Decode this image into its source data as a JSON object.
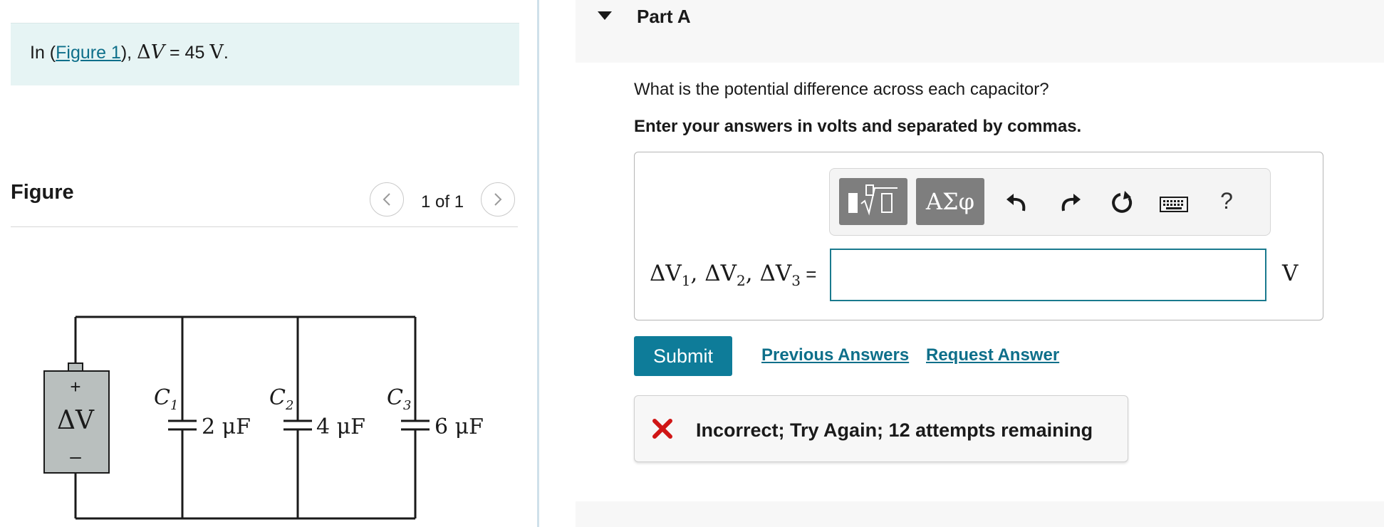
{
  "problem": {
    "prefix": "In (",
    "figure_link": "Figure 1",
    "suffix": "), ",
    "math_delta": "Δ",
    "math_var": "V",
    "math_eq": " = 45 ",
    "math_unit": "V",
    "period": "."
  },
  "figure": {
    "heading": "Figure",
    "pager_text": "1 of 1",
    "circuit": {
      "battery_plus": "+",
      "battery_label": "ΔV",
      "battery_minus": "–",
      "capacitors": [
        {
          "label": "C",
          "sub": "1",
          "value": "2 μF"
        },
        {
          "label": "C",
          "sub": "2",
          "value": "4 μF"
        },
        {
          "label": "C",
          "sub": "3",
          "value": "6 μF"
        }
      ]
    }
  },
  "part": {
    "title": "Part A",
    "question": "What is the potential difference across each capacitor?",
    "instruction": "Enter your answers in volts and separated by commas.",
    "toolbar": {
      "symbols_label": "ΑΣφ",
      "help_label": "?"
    },
    "equation_label": {
      "d1": "ΔV",
      "s1": "1",
      "sep1": ", ",
      "d2": "ΔV",
      "s2": "2",
      "sep2": ", ",
      "d3": "ΔV",
      "s3": "3",
      "eq": " ="
    },
    "answer_value": "",
    "unit": "V",
    "submit_label": "Submit",
    "previous_answers_label": "Previous Answers",
    "request_answer_label": "Request Answer",
    "feedback_text": "Incorrect; Try Again; 12 attempts remaining"
  },
  "colors": {
    "accent": "#0e7c99",
    "link": "#0e6f8a",
    "error": "#d01616",
    "problem_bg": "#e6f4f4"
  }
}
